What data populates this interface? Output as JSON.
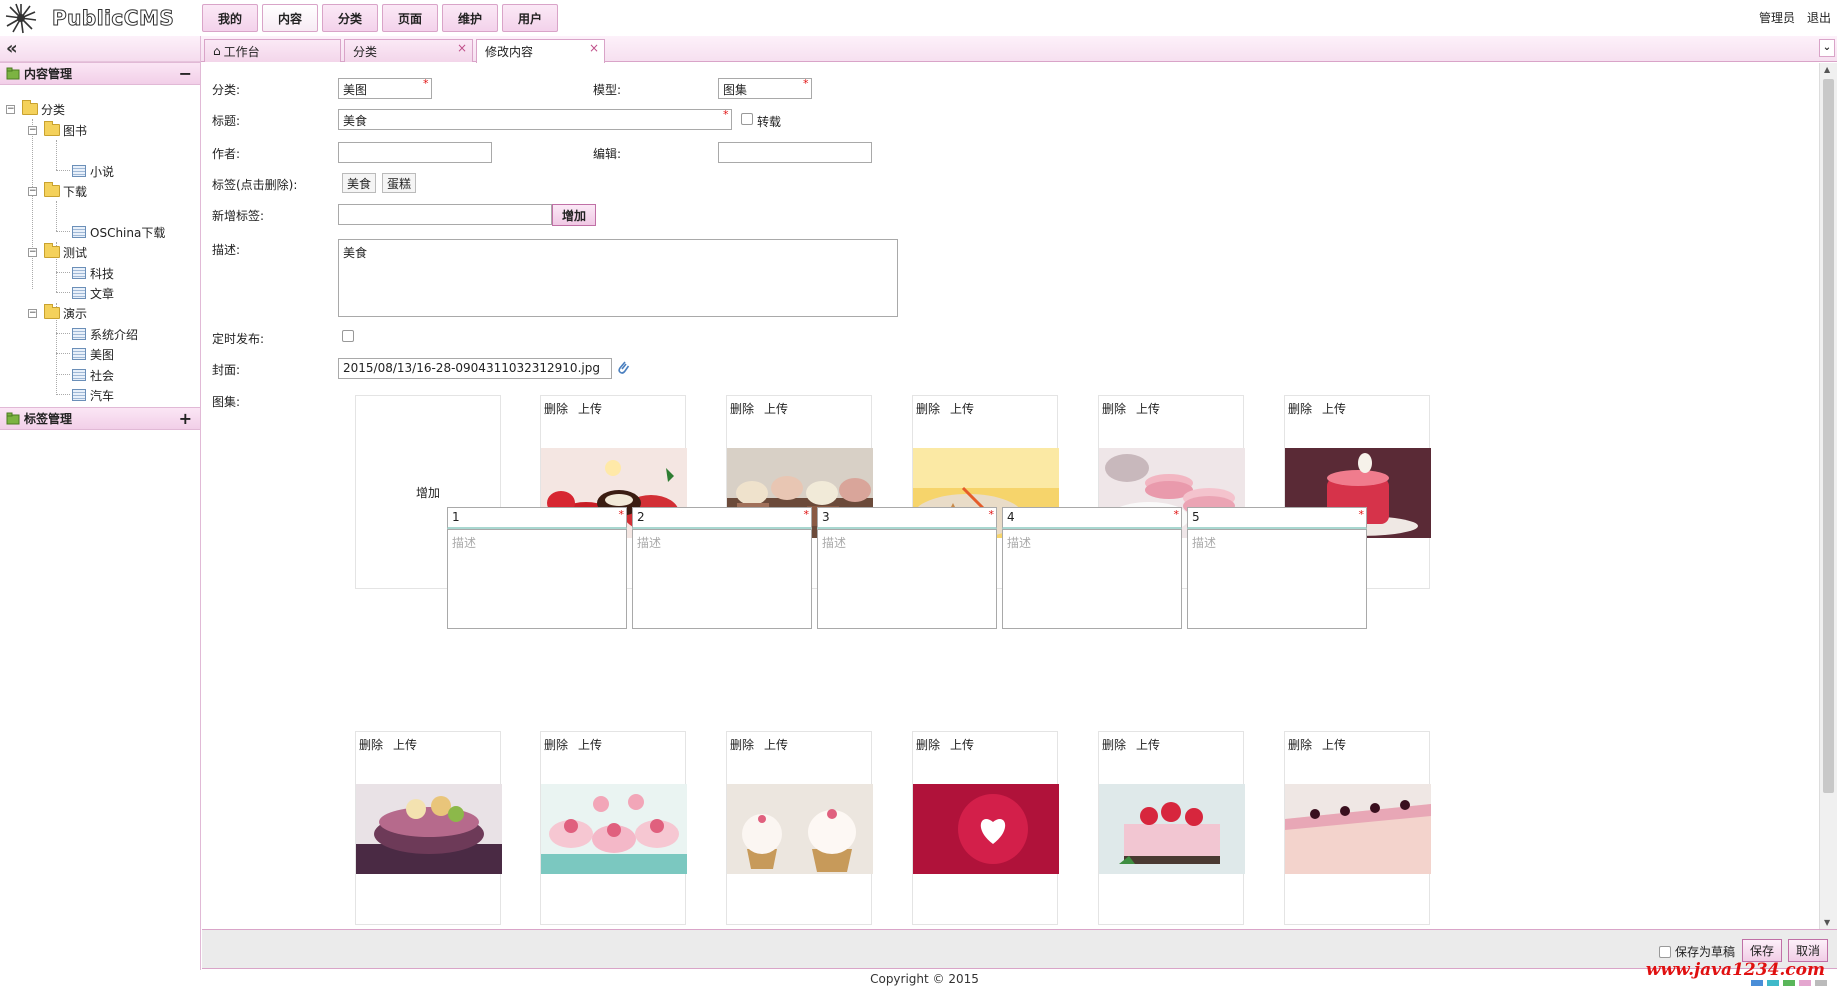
{
  "app": {
    "logo_text": "PublicCMS"
  },
  "nav": [
    {
      "label": "我的",
      "active": false
    },
    {
      "label": "内容",
      "active": true
    },
    {
      "label": "分类",
      "active": false
    },
    {
      "label": "页面",
      "active": false
    },
    {
      "label": "维护",
      "active": false
    },
    {
      "label": "用户",
      "active": false
    }
  ],
  "user": {
    "name": "管理员",
    "logout": "退出"
  },
  "sidebar": {
    "content_panel": "内容管理",
    "tag_panel": "标签管理",
    "tree": {
      "root": "分类",
      "books": "图书",
      "novel": "小说",
      "download": "下载",
      "oschina": "OSChina下载",
      "test": "测试",
      "tech": "科技",
      "article": "文章",
      "demo": "演示",
      "intro": "系统介绍",
      "pics": "美图",
      "society": "社会",
      "car": "汽车"
    }
  },
  "tabs": {
    "dashboard": "工作台",
    "category": "分类",
    "edit": "修改内容"
  },
  "form": {
    "category_label": "分类:",
    "category_value": "美图",
    "model_label": "模型:",
    "model_value": "图集",
    "title_label": "标题:",
    "title_value": "美食",
    "copied_label": "转载",
    "author_label": "作者:",
    "author_value": "",
    "editor_label": "编辑:",
    "editor_value": "",
    "tags_label": "标签(点击删除):",
    "tags": [
      "美食",
      "蛋糕"
    ],
    "new_tag_label": "新增标签:",
    "new_tag_value": "",
    "add_label": "增加",
    "desc_label": "描述:",
    "desc_value": "美食",
    "schedule_label": "定时发布:",
    "cover_label": "封面:",
    "cover_value": "2015/08/13/16-28-0904311032312910.jpg",
    "gallery_label": "图集:",
    "gallery_add": "增加",
    "delete_label": "删除",
    "upload_label": "上传",
    "desc_placeholder": "描述",
    "captions": [
      "1",
      "2",
      "3",
      "4",
      "5"
    ]
  },
  "gallery_images": {
    "row1": [
      "strawberry-chocolate-cake",
      "cupcakes-box",
      "star-cookies",
      "pink-macarons",
      "raspberry-cake"
    ],
    "row2": [
      "fruit-cake",
      "rose-cupcakes",
      "cream-tarts",
      "heart-cupcake",
      "strawberry-mousse",
      "berry-cheesecake"
    ]
  },
  "footer": {
    "draft_label": "保存为草稿",
    "save_label": "保存",
    "cancel_label": "取消",
    "copyright": "Copyright © 2015",
    "watermark": "www.java1234.com"
  },
  "colors": {
    "accent": "#f3d2eb",
    "border": "#d9a4c8",
    "required": "#e01010"
  }
}
